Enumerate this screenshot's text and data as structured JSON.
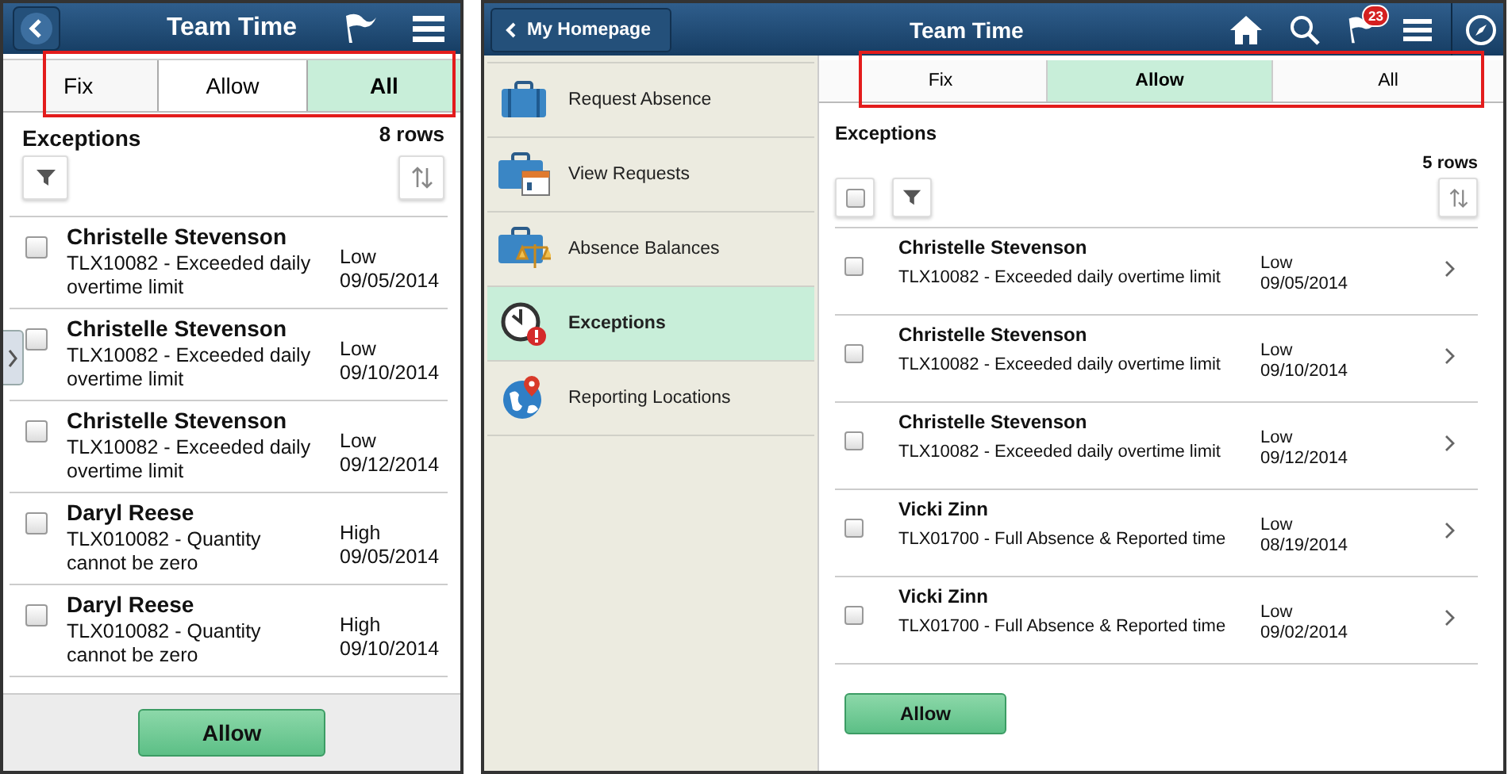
{
  "phone_view": {
    "title": "Team Time",
    "tabs": [
      {
        "label": "Fix",
        "selected": false
      },
      {
        "label": "Allow",
        "selected": false
      },
      {
        "label": "All",
        "selected": true
      }
    ],
    "section_title": "Exceptions",
    "row_count": "8 rows",
    "rows": [
      {
        "name": "Christelle Stevenson",
        "detail": "TLX10082 - Exceeded daily overtime limit",
        "priority": "Low",
        "date": "09/05/2014",
        "checked": false
      },
      {
        "name": "Christelle Stevenson",
        "detail": "TLX10082 - Exceeded daily overtime limit",
        "priority": "Low",
        "date": "09/10/2014",
        "checked": false
      },
      {
        "name": "Christelle Stevenson",
        "detail": "TLX10082 - Exceeded daily overtime limit",
        "priority": "Low",
        "date": "09/12/2014",
        "checked": false
      },
      {
        "name": "Daryl Reese",
        "detail": "TLX010082 - Quantity cannot be zero",
        "priority": "High",
        "date": "09/05/2014",
        "checked": false
      },
      {
        "name": "Daryl Reese",
        "detail": "TLX010082 - Quantity cannot be zero",
        "priority": "High",
        "date": "09/10/2014",
        "checked": false
      }
    ],
    "action_button": "Allow"
  },
  "tablet_view": {
    "back_button": "My Homepage",
    "title": "Team Time",
    "notification_count": "23",
    "sidebar": [
      {
        "label": "Request Absence",
        "selected": false
      },
      {
        "label": "View Requests",
        "selected": false
      },
      {
        "label": "Absence Balances",
        "selected": false
      },
      {
        "label": "Exceptions",
        "selected": true
      },
      {
        "label": "Reporting Locations",
        "selected": false
      }
    ],
    "tabs": [
      {
        "label": "Fix",
        "selected": false
      },
      {
        "label": "Allow",
        "selected": true
      },
      {
        "label": "All",
        "selected": false
      }
    ],
    "section_title": "Exceptions",
    "row_count": "5 rows",
    "rows": [
      {
        "name": "Christelle Stevenson",
        "detail": "TLX10082 - Exceeded daily overtime limit",
        "priority": "Low",
        "date": "09/05/2014",
        "checked": false
      },
      {
        "name": "Christelle Stevenson",
        "detail": "TLX10082 - Exceeded daily overtime limit",
        "priority": "Low",
        "date": "09/10/2014",
        "checked": false
      },
      {
        "name": "Christelle Stevenson",
        "detail": "TLX10082 - Exceeded daily overtime limit",
        "priority": "Low",
        "date": "09/12/2014",
        "checked": false
      },
      {
        "name": "Vicki Zinn",
        "detail": "TLX01700 - Full Absence & Reported time",
        "priority": "Low",
        "date": "08/19/2014",
        "checked": false
      },
      {
        "name": "Vicki Zinn",
        "detail": "TLX01700 - Full Absence & Reported time",
        "priority": "Low",
        "date": "09/02/2014",
        "checked": false
      }
    ],
    "action_button": "Allow"
  }
}
